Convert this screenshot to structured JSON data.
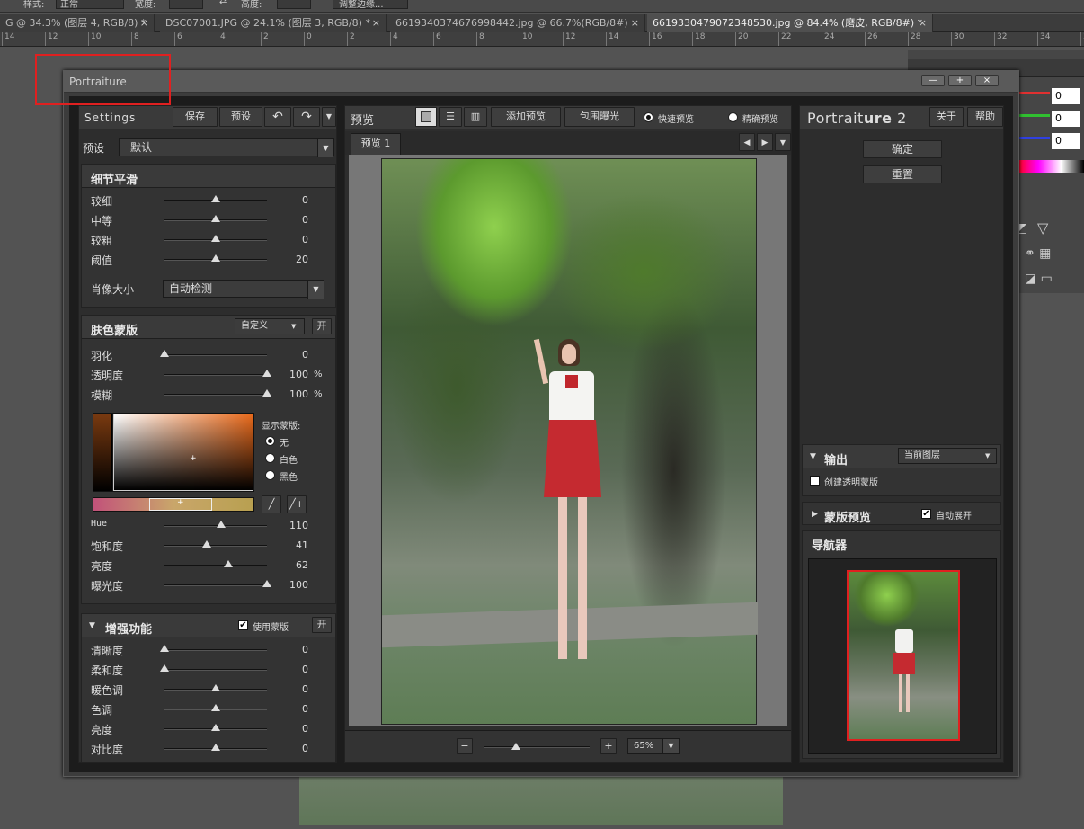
{
  "ps": {
    "optbar": {
      "mode_label": "样式:",
      "mode_value": "正常",
      "width_label": "宽度:",
      "height_label": "高度:",
      "refine_label": "调整边缘..."
    },
    "tabs": [
      {
        "label": "G @ 34.3% (图层 4, RGB/8) *",
        "close": "×"
      },
      {
        "label": "DSC07001.JPG @ 24.1% (图层 3, RGB/8) *",
        "close": "×"
      },
      {
        "label": "6619340374676998442.jpg @ 66.7%(RGB/8#)",
        "close": "×"
      },
      {
        "label": "6619330479072348530.jpg @ 84.4% (磨皮, RGB/8#) *",
        "close": "×"
      }
    ],
    "ruler": [
      "14",
      "12",
      "10",
      "8",
      "6",
      "4",
      "2",
      "0",
      "2",
      "4",
      "6",
      "8",
      "10",
      "12",
      "14",
      "16",
      "18",
      "20",
      "22",
      "24",
      "26",
      "28",
      "30",
      "32",
      "34",
      "3"
    ],
    "color_values": [
      "0",
      "0",
      "0"
    ]
  },
  "dialog": {
    "title": "Portraiture",
    "win_buttons": [
      "—",
      "+",
      "×"
    ],
    "left": {
      "settings_label": "Settings",
      "save": "保存",
      "preset_btn": "预设",
      "undo": "↶",
      "redo": "↷",
      "menu": "▼",
      "preset_label": "预设",
      "preset_value": "默认",
      "detail": {
        "title": "细节平滑",
        "rows": [
          {
            "label": "较细",
            "value": "0"
          },
          {
            "label": "中等",
            "value": "0"
          },
          {
            "label": "较粗",
            "value": "0"
          },
          {
            "label": "阈值",
            "value": "20"
          }
        ],
        "portrait_size_label": "肖像大小",
        "portrait_size_value": "自动检测"
      },
      "skin": {
        "title": "肤色蒙版",
        "mode_value": "自定义",
        "on_btn": "开",
        "rows": [
          {
            "label": "羽化",
            "value": "0",
            "unit": ""
          },
          {
            "label": "透明度",
            "value": "100",
            "unit": "%"
          },
          {
            "label": "模糊",
            "value": "100",
            "unit": "%"
          }
        ],
        "show_mask_label": "显示蒙版:",
        "mask_options": [
          "无",
          "白色",
          "黑色"
        ],
        "rows2": [
          {
            "label": "Hue",
            "value": "110"
          },
          {
            "label": "饱和度",
            "value": "41"
          },
          {
            "label": "亮度",
            "value": "62"
          },
          {
            "label": "曝光度",
            "value": "100"
          }
        ]
      },
      "enhance": {
        "title": "增强功能",
        "use_mask": "使用蒙版",
        "on_btn": "开",
        "rows": [
          {
            "label": "清晰度",
            "value": "0"
          },
          {
            "label": "柔和度",
            "value": "0"
          },
          {
            "label": "暖色调",
            "value": "0"
          },
          {
            "label": "色调",
            "value": "0"
          },
          {
            "label": "亮度",
            "value": "0"
          },
          {
            "label": "对比度",
            "value": "0"
          }
        ]
      }
    },
    "center": {
      "title": "预览",
      "add_preview": "添加预览",
      "clip_exposure": "包围曝光",
      "fast_preview": "快速预览",
      "accurate_preview": "精确预览",
      "tab": "预览 1",
      "zoom_minus": "−",
      "zoom_plus": "+",
      "zoom_value": "65%"
    },
    "right": {
      "logo_main": "Portrait",
      "logo_bold": "ure",
      "logo_num": "2",
      "about": "关于",
      "help": "帮助",
      "ok": "确定",
      "reset": "重置",
      "output_label": "输出",
      "output_value": "当前图层",
      "create_transparent": "创建透明蒙版",
      "mask_preview": "蒙版预览",
      "auto_expand": "自动展开",
      "navigator": "导航器"
    }
  },
  "colors": {
    "accent_red": "#e02020",
    "panel": "#2d2d2d"
  }
}
